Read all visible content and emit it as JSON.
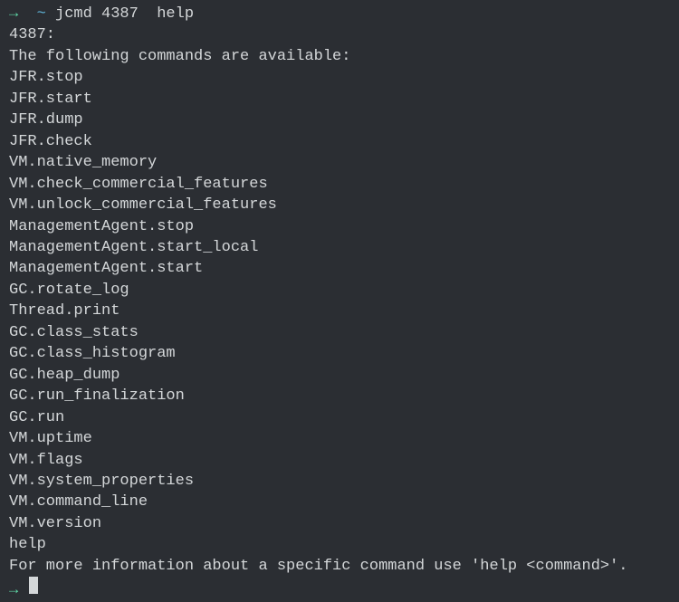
{
  "prompt": {
    "arrow": "→ ",
    "tilde": " ~ ",
    "command": "jcmd 4387  help"
  },
  "output": {
    "pid_line": "4387:",
    "header": "The following commands are available:",
    "commands": [
      "JFR.stop",
      "JFR.start",
      "JFR.dump",
      "JFR.check",
      "VM.native_memory",
      "VM.check_commercial_features",
      "VM.unlock_commercial_features",
      "ManagementAgent.stop",
      "ManagementAgent.start_local",
      "ManagementAgent.start",
      "GC.rotate_log",
      "Thread.print",
      "GC.class_stats",
      "GC.class_histogram",
      "GC.heap_dump",
      "GC.run_finalization",
      "GC.run",
      "VM.uptime",
      "VM.flags",
      "VM.system_properties",
      "VM.command_line",
      "VM.version",
      "help"
    ],
    "footer_blank": "",
    "footer": "For more information about a specific command use 'help <command>'."
  },
  "next_prompt": {
    "arrow": "→ "
  }
}
